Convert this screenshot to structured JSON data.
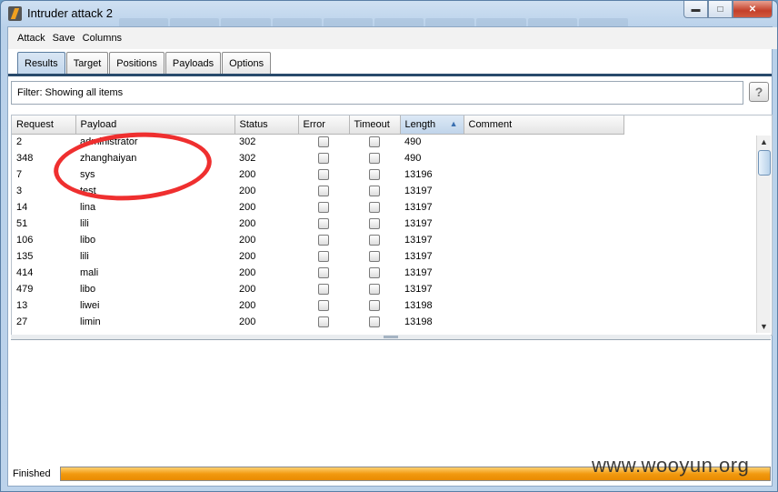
{
  "window": {
    "title": "Intruder attack 2"
  },
  "menu": [
    "Attack",
    "Save",
    "Columns"
  ],
  "tabs": [
    "Results",
    "Target",
    "Positions",
    "Payloads",
    "Options"
  ],
  "active_tab": "Results",
  "filter": {
    "text": "Filter:  Showing all items"
  },
  "help_label": "?",
  "table": {
    "columns": [
      "Request",
      "Payload",
      "Status",
      "Error",
      "Timeout",
      "Length",
      "Comment"
    ],
    "sorted_column": "Length",
    "sort_direction": "ascending",
    "rows": [
      {
        "request": "2",
        "payload": "administrator",
        "status": "302",
        "length": "490",
        "comment": ""
      },
      {
        "request": "348",
        "payload": "zhanghaiyan",
        "status": "302",
        "length": "490",
        "comment": ""
      },
      {
        "request": "7",
        "payload": "sys",
        "status": "200",
        "length": "13196",
        "comment": ""
      },
      {
        "request": "3",
        "payload": "test",
        "status": "200",
        "length": "13197",
        "comment": ""
      },
      {
        "request": "14",
        "payload": "lina",
        "status": "200",
        "length": "13197",
        "comment": ""
      },
      {
        "request": "51",
        "payload": "lili",
        "status": "200",
        "length": "13197",
        "comment": ""
      },
      {
        "request": "106",
        "payload": "libo",
        "status": "200",
        "length": "13197",
        "comment": ""
      },
      {
        "request": "135",
        "payload": "lili",
        "status": "200",
        "length": "13197",
        "comment": ""
      },
      {
        "request": "414",
        "payload": "mali",
        "status": "200",
        "length": "13197",
        "comment": ""
      },
      {
        "request": "479",
        "payload": "libo",
        "status": "200",
        "length": "13197",
        "comment": ""
      },
      {
        "request": "13",
        "payload": "liwei",
        "status": "200",
        "length": "13198",
        "comment": ""
      },
      {
        "request": "27",
        "payload": "limin",
        "status": "200",
        "length": "13198",
        "comment": ""
      }
    ]
  },
  "status": {
    "text": "Finished",
    "progress": 1.0
  },
  "watermark": "www.wooyun.org",
  "colors": {
    "progress": "#f29a10",
    "annotation": "#ef2f2f",
    "tab_underline": "#284a6c"
  },
  "icons": {
    "app": "burp-lightning-icon",
    "minimize": "minimize-icon",
    "maximize": "maximize-icon",
    "close": "close-icon"
  }
}
